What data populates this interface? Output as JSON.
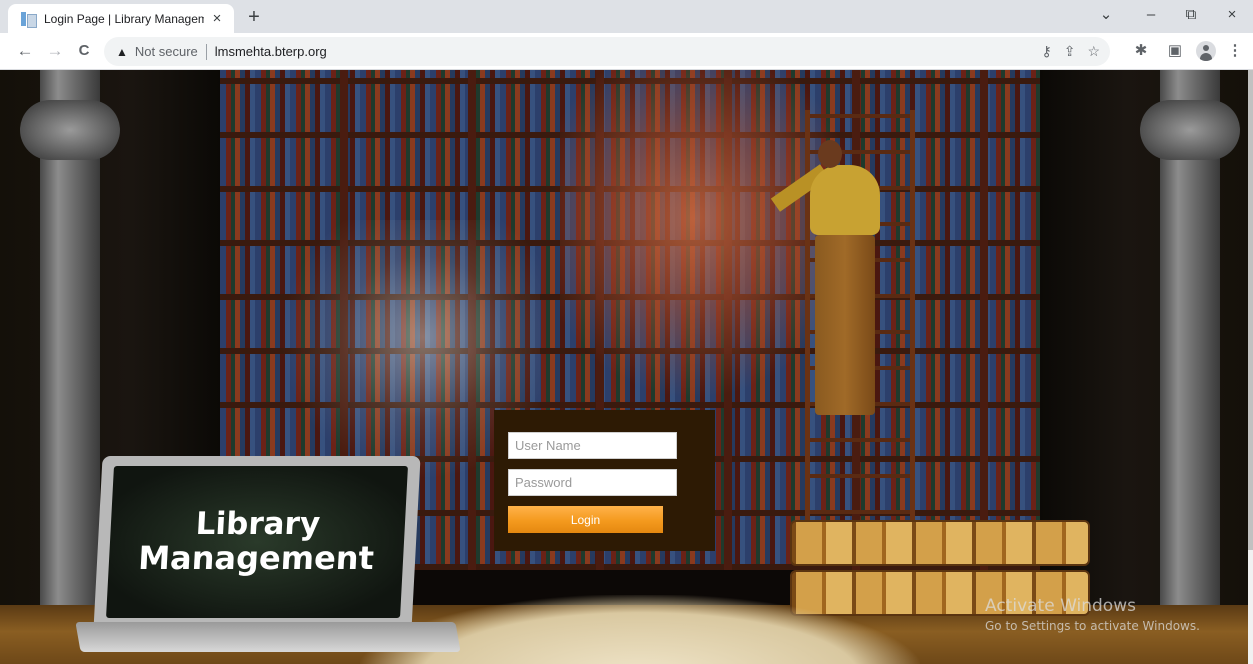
{
  "browser": {
    "tab": {
      "title": "Login Page | Library Managemen",
      "close_glyph": "×"
    },
    "new_tab_glyph": "+",
    "window_controls": {
      "tab_search": "⌄",
      "minimize": "–",
      "restore": "⧉",
      "close": "×"
    },
    "nav": {
      "back": "←",
      "forward": "→",
      "reload": "C"
    },
    "omnibox": {
      "warning_glyph": "▲",
      "security_label": "Not secure",
      "url": "lmsmehta.bterp.org"
    },
    "omnibox_icons": {
      "key": "⚷",
      "share": "⇪",
      "bookmark": "☆"
    },
    "toolbar_icons": {
      "extensions": "✱",
      "side_panel": "▣",
      "menu": "⋮"
    }
  },
  "page": {
    "laptop_text": {
      "line1": "Library",
      "line2": "Management"
    },
    "login": {
      "username_placeholder": "User Name",
      "password_placeholder": "Password",
      "button_label": "Login"
    },
    "watermark": {
      "title": "Activate Windows",
      "subtitle": "Go to Settings to activate Windows."
    }
  },
  "colors": {
    "login_panel": "#2d1a04",
    "login_button": "#f49a1e",
    "tab_strip": "#dee1e6"
  }
}
